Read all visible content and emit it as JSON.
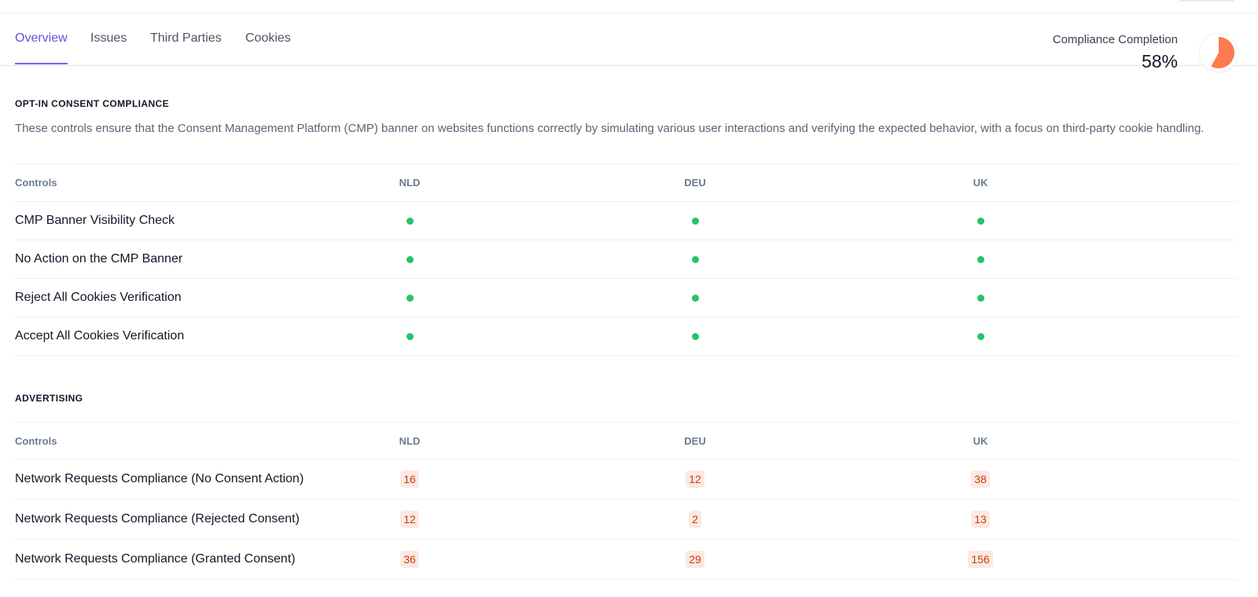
{
  "tabs": [
    {
      "label": "Overview",
      "active": true
    },
    {
      "label": "Issues",
      "active": false
    },
    {
      "label": "Third Parties",
      "active": false
    },
    {
      "label": "Cookies",
      "active": false
    }
  ],
  "completion": {
    "label": "Compliance Completion",
    "value_text": "58%",
    "fraction": 0.58,
    "color": "#ff7a4f"
  },
  "consent_section": {
    "title": "OPT-IN CONSENT COMPLIANCE",
    "description": "These controls ensure that the Consent Management Platform (CMP) banner on websites functions correctly by simulating various user interactions and verifying the expected behavior, with a focus on third-party cookie handling.",
    "columns": [
      "Controls",
      "NLD",
      "DEU",
      "UK"
    ],
    "rows": [
      {
        "label": "CMP Banner Visibility Check",
        "status": [
          "pass",
          "pass",
          "pass"
        ]
      },
      {
        "label": "No Action on the CMP Banner",
        "status": [
          "pass",
          "pass",
          "pass"
        ]
      },
      {
        "label": "Reject All Cookies Verification",
        "status": [
          "pass",
          "pass",
          "pass"
        ]
      },
      {
        "label": "Accept All Cookies Verification",
        "status": [
          "pass",
          "pass",
          "pass"
        ]
      }
    ],
    "status_color": "#22c56a"
  },
  "advertising_section": {
    "title": "ADVERTISING",
    "columns": [
      "Controls",
      "NLD",
      "DEU",
      "UK"
    ],
    "rows": [
      {
        "label": "Network Requests Compliance (No Consent Action)",
        "values": [
          "16",
          "12",
          "38"
        ]
      },
      {
        "label": "Network Requests Compliance (Rejected Consent)",
        "values": [
          "12",
          "2",
          "13"
        ]
      },
      {
        "label": "Network Requests Compliance (Granted Consent)",
        "values": [
          "36",
          "29",
          "156"
        ]
      }
    ],
    "badge_color": "#c2410c"
  }
}
